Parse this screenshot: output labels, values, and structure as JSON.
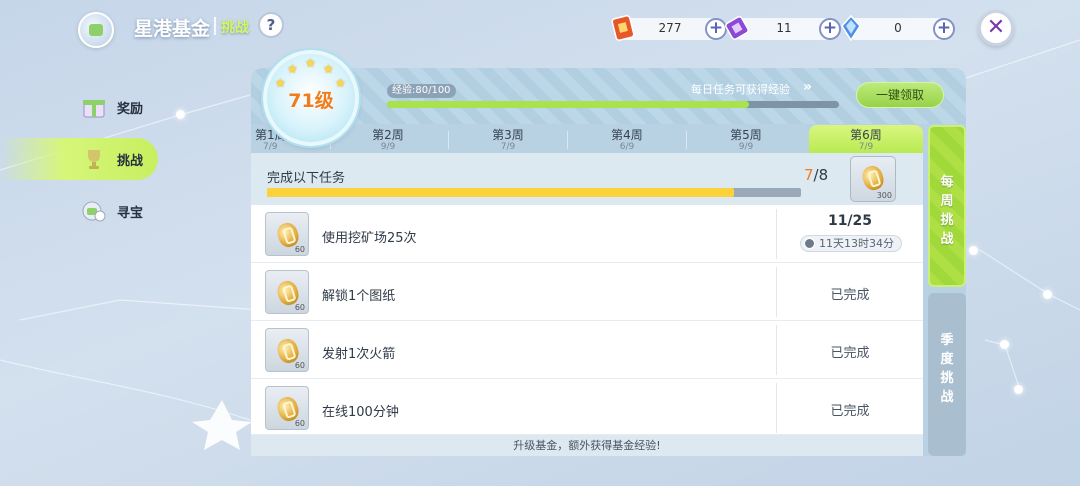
{
  "header": {
    "title": "星港基金",
    "tag": "挑战",
    "help": "?",
    "close": "✕"
  },
  "currencies": [
    {
      "name": "red-ticket",
      "value": "277",
      "color": "#e8572a"
    },
    {
      "name": "purple-ticket",
      "value": "11",
      "color": "#8a4ad6"
    },
    {
      "name": "blue-crystal",
      "value": "0",
      "color": "#4f8fe8"
    }
  ],
  "sidebar": {
    "items": [
      {
        "label": "奖励",
        "icon": "gift-icon",
        "active": false
      },
      {
        "label": "挑战",
        "icon": "trophy-icon",
        "active": true
      },
      {
        "label": "寻宝",
        "icon": "treasure-icon",
        "active": false
      }
    ]
  },
  "level": {
    "text": "71级"
  },
  "exp": {
    "label": "经验:80/100",
    "current": 80,
    "max": 100,
    "hint": "每日任务可获得经验",
    "claim_button": "一键领取"
  },
  "weeks": [
    {
      "name": "第1周",
      "progress": "7/9"
    },
    {
      "name": "第2周",
      "progress": "9/9"
    },
    {
      "name": "第3周",
      "progress": "7/9"
    },
    {
      "name": "第4周",
      "progress": "6/9"
    },
    {
      "name": "第5周",
      "progress": "9/9"
    },
    {
      "name": "第6周",
      "progress": "7/9"
    }
  ],
  "active_week": 5,
  "task_header": {
    "label": "完成以下任务",
    "current": "7",
    "total": "/8",
    "reward_amount": "300"
  },
  "tasks": [
    {
      "label": "使用挖矿场25次",
      "reward": "60",
      "progress": "11/25",
      "timer": "11天13时34分",
      "status": ""
    },
    {
      "label": "解锁1个图纸",
      "reward": "60",
      "progress": "",
      "timer": "",
      "status": "已完成"
    },
    {
      "label": "发射1次火箭",
      "reward": "60",
      "progress": "",
      "timer": "",
      "status": "已完成"
    },
    {
      "label": "在线100分钟",
      "reward": "60",
      "progress": "",
      "timer": "",
      "status": "已完成"
    }
  ],
  "footer": "升级基金，额外获得基金经验!",
  "side_tabs": {
    "weekly": "每周挑战",
    "season": "季度挑战"
  }
}
